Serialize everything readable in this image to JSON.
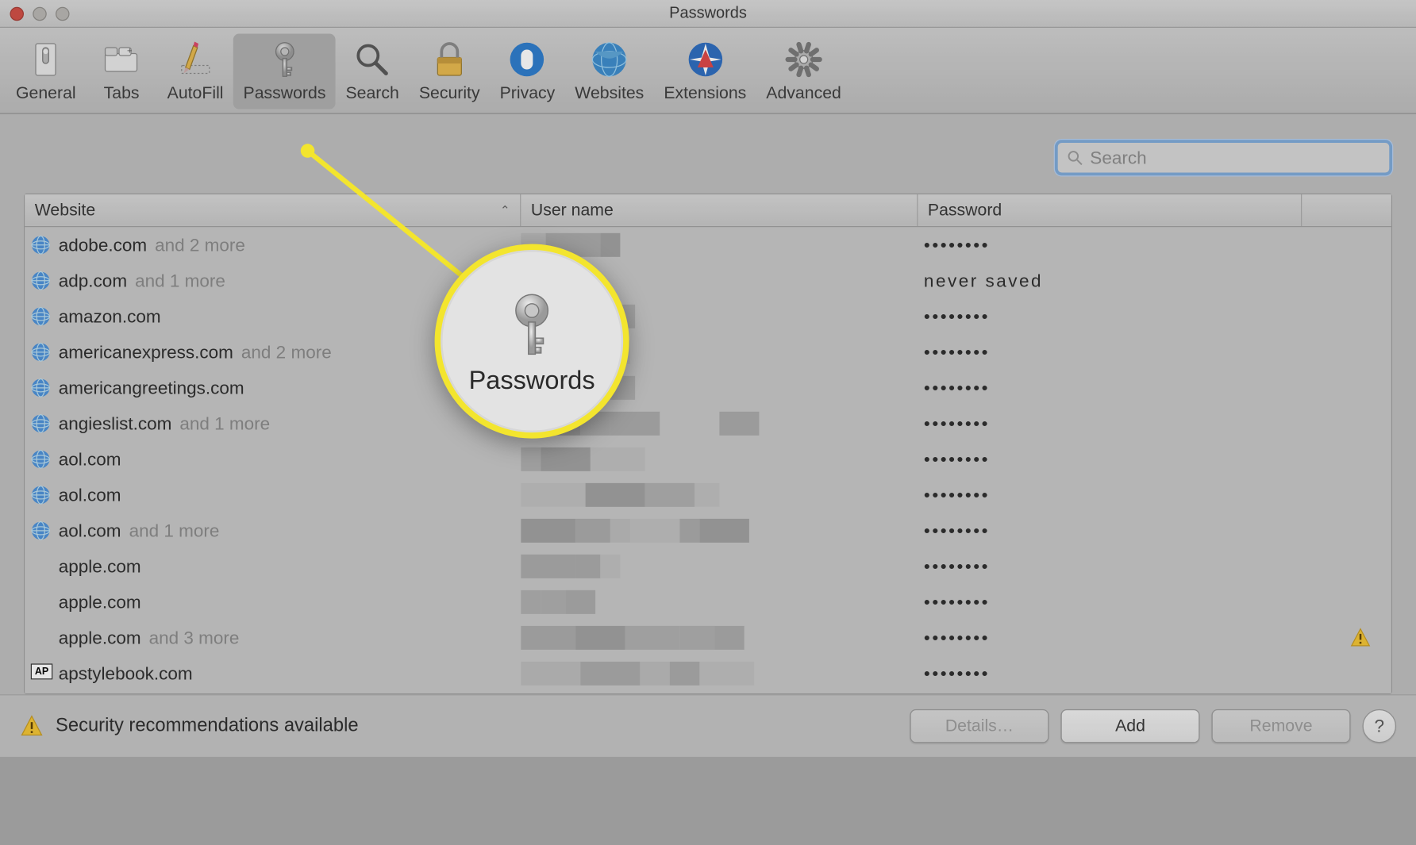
{
  "window": {
    "title": "Passwords"
  },
  "toolbar": {
    "items": [
      {
        "id": "general",
        "label": "General"
      },
      {
        "id": "tabs",
        "label": "Tabs"
      },
      {
        "id": "autofill",
        "label": "AutoFill"
      },
      {
        "id": "passwords",
        "label": "Passwords"
      },
      {
        "id": "search",
        "label": "Search"
      },
      {
        "id": "security",
        "label": "Security"
      },
      {
        "id": "privacy",
        "label": "Privacy"
      },
      {
        "id": "websites",
        "label": "Websites"
      },
      {
        "id": "extensions",
        "label": "Extensions"
      },
      {
        "id": "advanced",
        "label": "Advanced"
      }
    ],
    "selected": "passwords"
  },
  "search": {
    "placeholder": "Search",
    "value": ""
  },
  "table": {
    "columns": {
      "website": "Website",
      "username": "User name",
      "password": "Password"
    },
    "sort": {
      "column": "website",
      "dir": "asc"
    },
    "rows": [
      {
        "site": "adobe.com",
        "extra": "and 2 more",
        "icon": "globe",
        "user": "blurred",
        "pass": "••••••••"
      },
      {
        "site": "adp.com",
        "extra": "and 1 more",
        "icon": "globe",
        "user": "",
        "pass": "never saved"
      },
      {
        "site": "amazon.com",
        "extra": "",
        "icon": "globe",
        "user": "blurred",
        "pass": "••••••••"
      },
      {
        "site": "americanexpress.com",
        "extra": "and 2 more",
        "icon": "globe",
        "user": "blurred",
        "pass": "••••••••"
      },
      {
        "site": "americangreetings.com",
        "extra": "",
        "icon": "globe",
        "user": "blurred",
        "pass": "••••••••"
      },
      {
        "site": "angieslist.com",
        "extra": "and 1 more",
        "icon": "globe",
        "user": "blurred",
        "pass": "••••••••"
      },
      {
        "site": "aol.com",
        "extra": "",
        "icon": "globe",
        "user": "blurred",
        "pass": "••••••••"
      },
      {
        "site": "aol.com",
        "extra": "",
        "icon": "globe",
        "user": "blurred",
        "pass": "••••••••"
      },
      {
        "site": "aol.com",
        "extra": "and 1 more",
        "icon": "globe",
        "user": "blurred",
        "pass": "••••••••"
      },
      {
        "site": "apple.com",
        "extra": "",
        "icon": "apple",
        "user": "blurred",
        "pass": "••••••••"
      },
      {
        "site": "apple.com",
        "extra": "",
        "icon": "apple",
        "user": "blurred",
        "pass": "••••••••"
      },
      {
        "site": "apple.com",
        "extra": "and 3 more",
        "icon": "apple",
        "user": "blurred",
        "pass": "••••••••",
        "warn": true
      },
      {
        "site": "apstylebook.com",
        "extra": "",
        "icon": "ap",
        "user": "blurred",
        "pass": "••••••••"
      }
    ]
  },
  "footer": {
    "message": "Security recommendations available",
    "buttons": {
      "details": "Details…",
      "add": "Add",
      "remove": "Remove",
      "help": "?"
    }
  },
  "callout": {
    "label": "Passwords"
  }
}
